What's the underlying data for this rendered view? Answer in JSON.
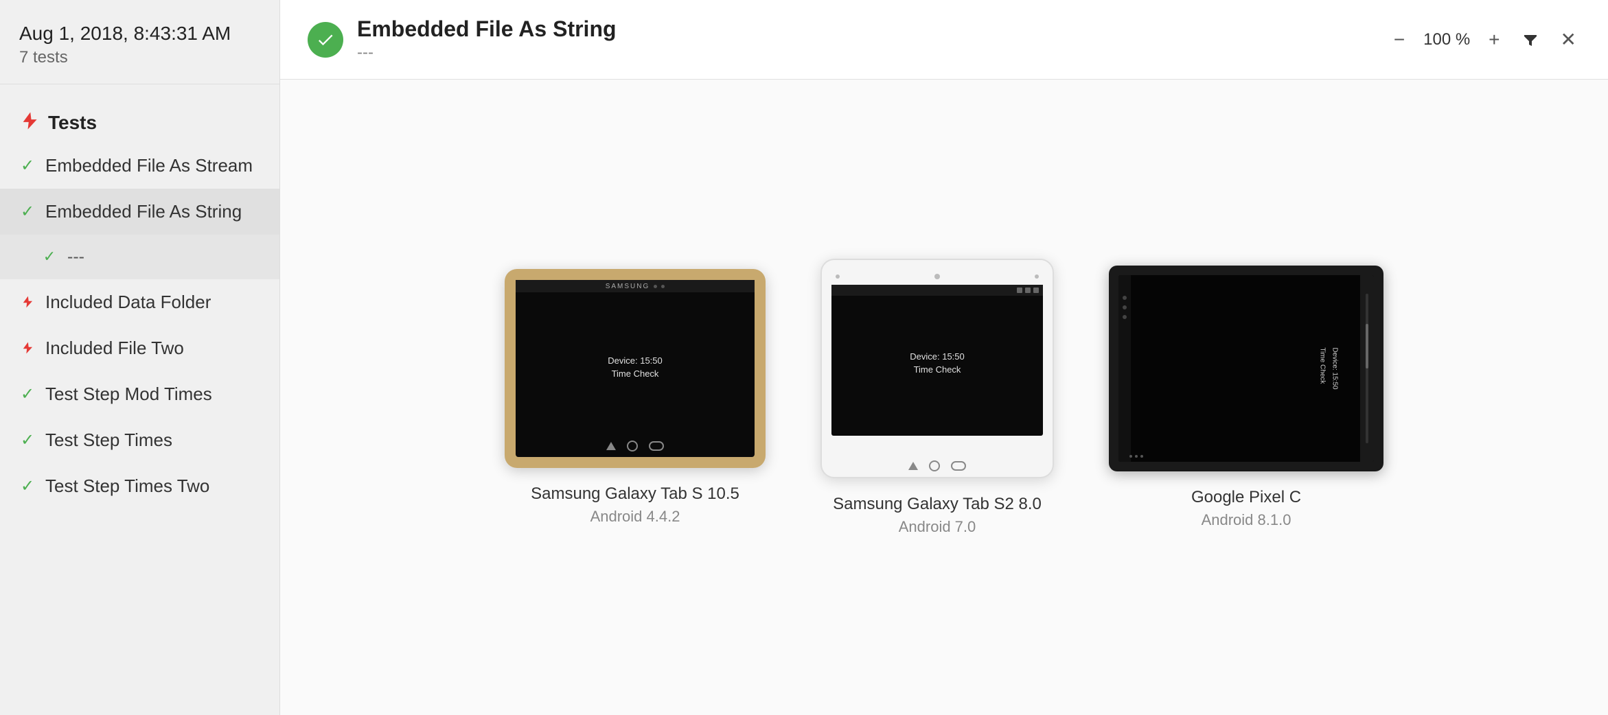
{
  "sidebar": {
    "date": "Aug 1, 2018, 8:43:31 AM",
    "test_count": "7 tests",
    "section_label": "Tests",
    "items": [
      {
        "id": "embedded-file-stream",
        "label": "Embedded File As Stream",
        "status": "check",
        "active": false,
        "sub": false
      },
      {
        "id": "embedded-file-string",
        "label": "Embedded File As String",
        "status": "check",
        "active": true,
        "sub": false
      },
      {
        "id": "dashes",
        "label": "---",
        "status": "check",
        "active": true,
        "sub": true
      },
      {
        "id": "included-data-folder",
        "label": "Included Data Folder",
        "status": "bolt",
        "active": false,
        "sub": false
      },
      {
        "id": "included-file-two",
        "label": "Included File Two",
        "status": "bolt",
        "active": false,
        "sub": false
      },
      {
        "id": "test-step-mod-times",
        "label": "Test Step Mod Times",
        "status": "check",
        "active": false,
        "sub": false
      },
      {
        "id": "test-step-times",
        "label": "Test Step Times",
        "status": "check",
        "active": false,
        "sub": false
      },
      {
        "id": "test-step-times-two",
        "label": "Test Step Times Two",
        "status": "check",
        "active": false,
        "sub": false
      }
    ]
  },
  "header": {
    "title": "Embedded File As String",
    "subtitle": "---",
    "zoom": "100 %",
    "status": "pass"
  },
  "devices": [
    {
      "id": "samsung-tab-s-105",
      "name": "Samsung Galaxy Tab S 10.5",
      "os": "Android 4.4.2",
      "screen_text": "Device: 15:50\nTime Check",
      "type": "s105"
    },
    {
      "id": "samsung-tab-s2-80",
      "name": "Samsung Galaxy Tab S2 8.0",
      "os": "Android 7.0",
      "screen_text": "Device: 15:50\nTime Check",
      "type": "s2"
    },
    {
      "id": "google-pixel-c",
      "name": "Google Pixel C",
      "os": "Android 8.1.0",
      "screen_text": "Device: 15:50\nTime Check",
      "type": "pixelc"
    }
  ],
  "controls": {
    "zoom_out_label": "−",
    "zoom_in_label": "+",
    "filter_label": "▼",
    "close_label": "✕"
  }
}
